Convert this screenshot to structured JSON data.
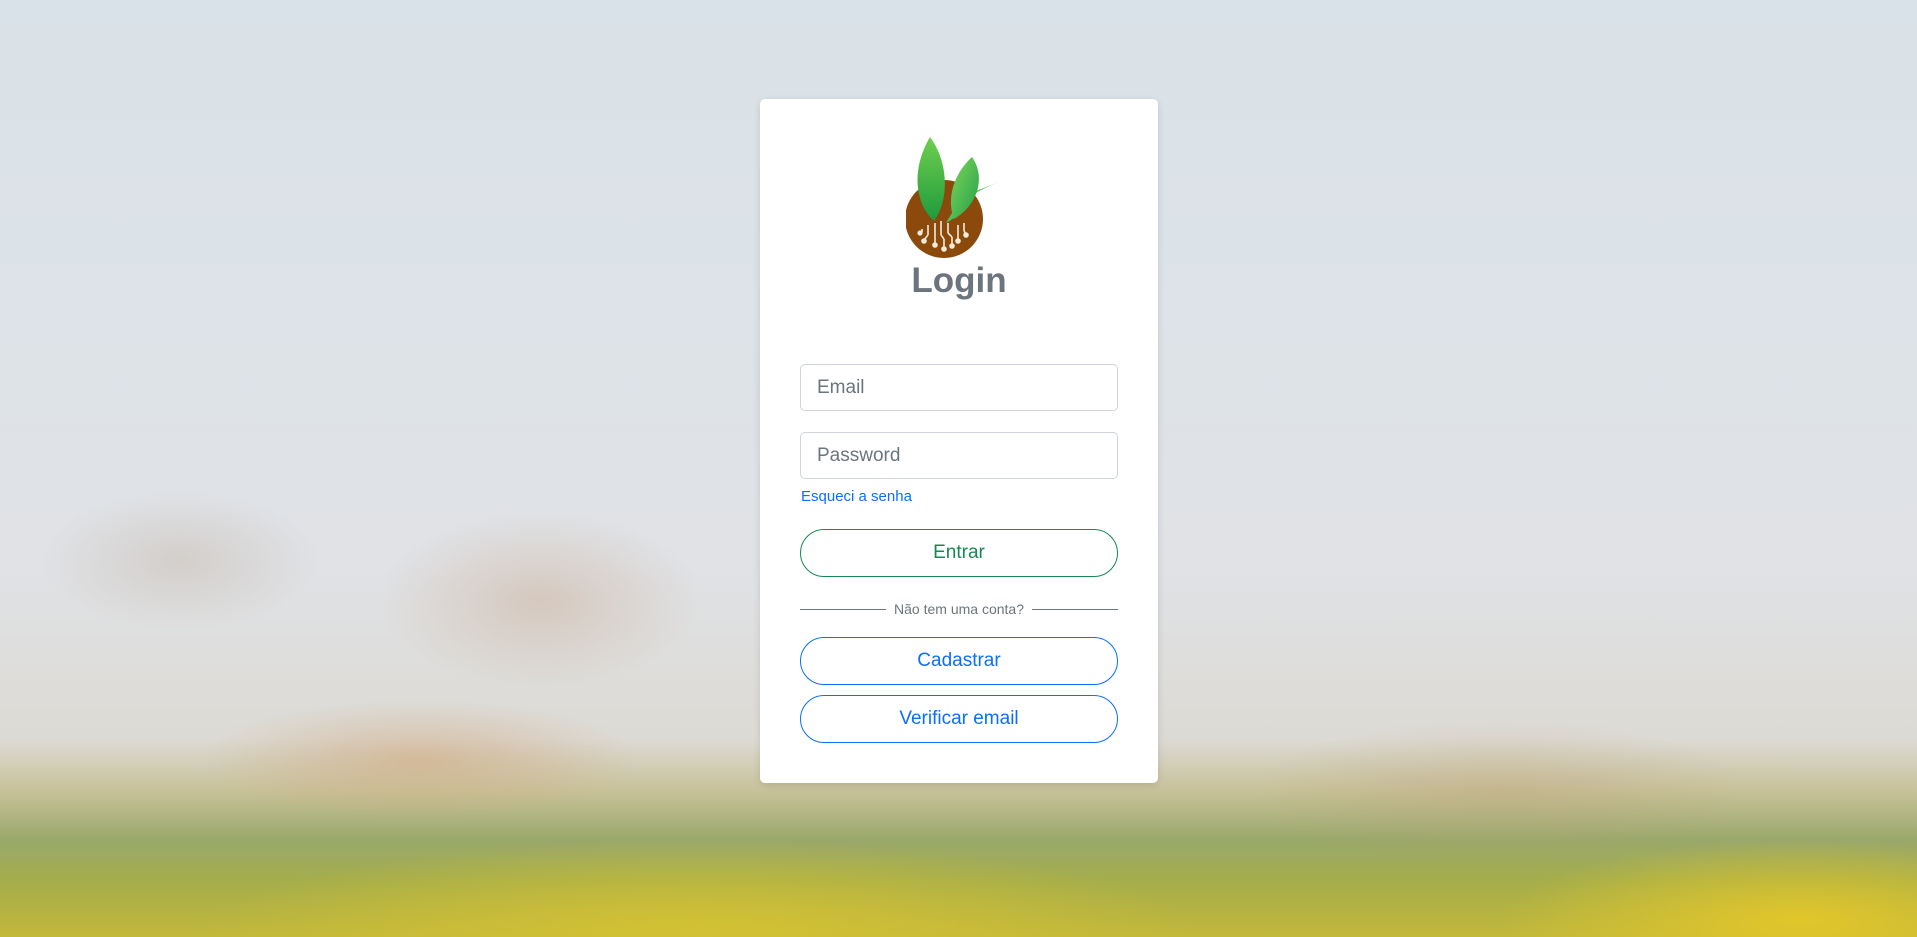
{
  "login": {
    "title": "Login",
    "email_placeholder": "Email",
    "password_placeholder": "Password",
    "forgot_password": "Esqueci a senha",
    "submit_label": "Entrar",
    "divider_text": "Não tem uma conta?",
    "signup_label": "Cadastrar",
    "verify_email_label": "Verificar email"
  },
  "icons": {
    "logo": "plant-circuit-logo-icon"
  },
  "colors": {
    "success": "#198754",
    "primary": "#0d6efd",
    "muted": "#6c757d",
    "leaf_green": "#2fae4a",
    "soil_brown": "#8b4a0c"
  }
}
